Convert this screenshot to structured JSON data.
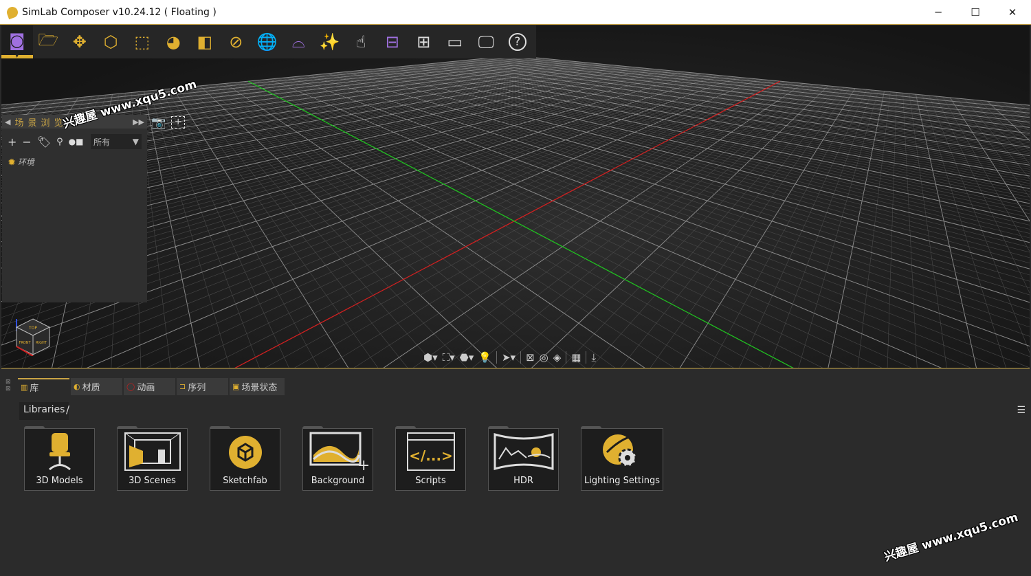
{
  "window": {
    "title": "SimLab Composer v10.24.12 ( Floating )",
    "minimize": "─",
    "maximize": "☐",
    "close": "✕"
  },
  "toolbar": {
    "items": [
      {
        "name": "vr-view",
        "icon": "vr-headset-icon",
        "color": "purple",
        "active": true
      },
      {
        "name": "open",
        "icon": "folder-icon"
      },
      {
        "name": "move",
        "icon": "move-icon"
      },
      {
        "name": "edit-geometry",
        "icon": "cube-pencil-icon"
      },
      {
        "name": "select-region",
        "icon": "selection-rect-icon"
      },
      {
        "name": "materials",
        "icon": "materials-icon"
      },
      {
        "name": "render",
        "icon": "render-icon"
      },
      {
        "name": "shading",
        "icon": "shading-icon"
      },
      {
        "name": "environment",
        "icon": "globe-icon"
      },
      {
        "name": "panorama-360",
        "icon": "panorama-360-icon",
        "color": "purple"
      },
      {
        "name": "effects",
        "icon": "magic-wand-icon",
        "color": "purple"
      },
      {
        "name": "interaction",
        "icon": "touch-icon",
        "color": "white"
      },
      {
        "name": "sequence",
        "icon": "flow-icon",
        "color": "purple"
      },
      {
        "name": "layout",
        "icon": "grid-panel-icon",
        "color": "white"
      },
      {
        "name": "vr-experience",
        "icon": "vr-goggles-icon",
        "color": "white"
      },
      {
        "name": "presentation",
        "icon": "presenter-icon",
        "color": "white"
      },
      {
        "name": "help",
        "icon": "help-icon",
        "color": "white"
      }
    ]
  },
  "scene_browser": {
    "title": "场景浏览",
    "filter": "所有",
    "items": [
      {
        "label": "环境",
        "icon": "sun-icon"
      }
    ]
  },
  "navcube": {
    "top": "TOP",
    "front": "FRONT",
    "right": "RIGHT"
  },
  "watermark": "兴趣屋 www.xqu5.com",
  "bottom_tabs": [
    {
      "label": "库",
      "icon": "library-icon",
      "active": true
    },
    {
      "label": "材质",
      "icon": "material-icon"
    },
    {
      "label": "动画",
      "icon": "animation-icon"
    },
    {
      "label": "序列",
      "icon": "sequence-icon"
    },
    {
      "label": "场景状态",
      "icon": "scene-state-icon"
    }
  ],
  "breadcrumb": {
    "root": "Libraries",
    "sep": "/"
  },
  "libraries": [
    {
      "label": "3D Models",
      "icon": "chair-icon"
    },
    {
      "label": "3D Scenes",
      "icon": "room-icon"
    },
    {
      "label": "Sketchfab",
      "icon": "sketchfab-icon"
    },
    {
      "label": "Background",
      "icon": "background-image-icon"
    },
    {
      "label": "Scripts",
      "icon": "code-icon"
    },
    {
      "label": "HDR",
      "icon": "hdr-panorama-icon"
    },
    {
      "label": "Lighting Settings",
      "icon": "lighting-gear-icon"
    }
  ],
  "colors": {
    "accent": "#e0b030",
    "purple": "#a070e0",
    "axis_x": "#d02020",
    "axis_z": "#20c020"
  }
}
